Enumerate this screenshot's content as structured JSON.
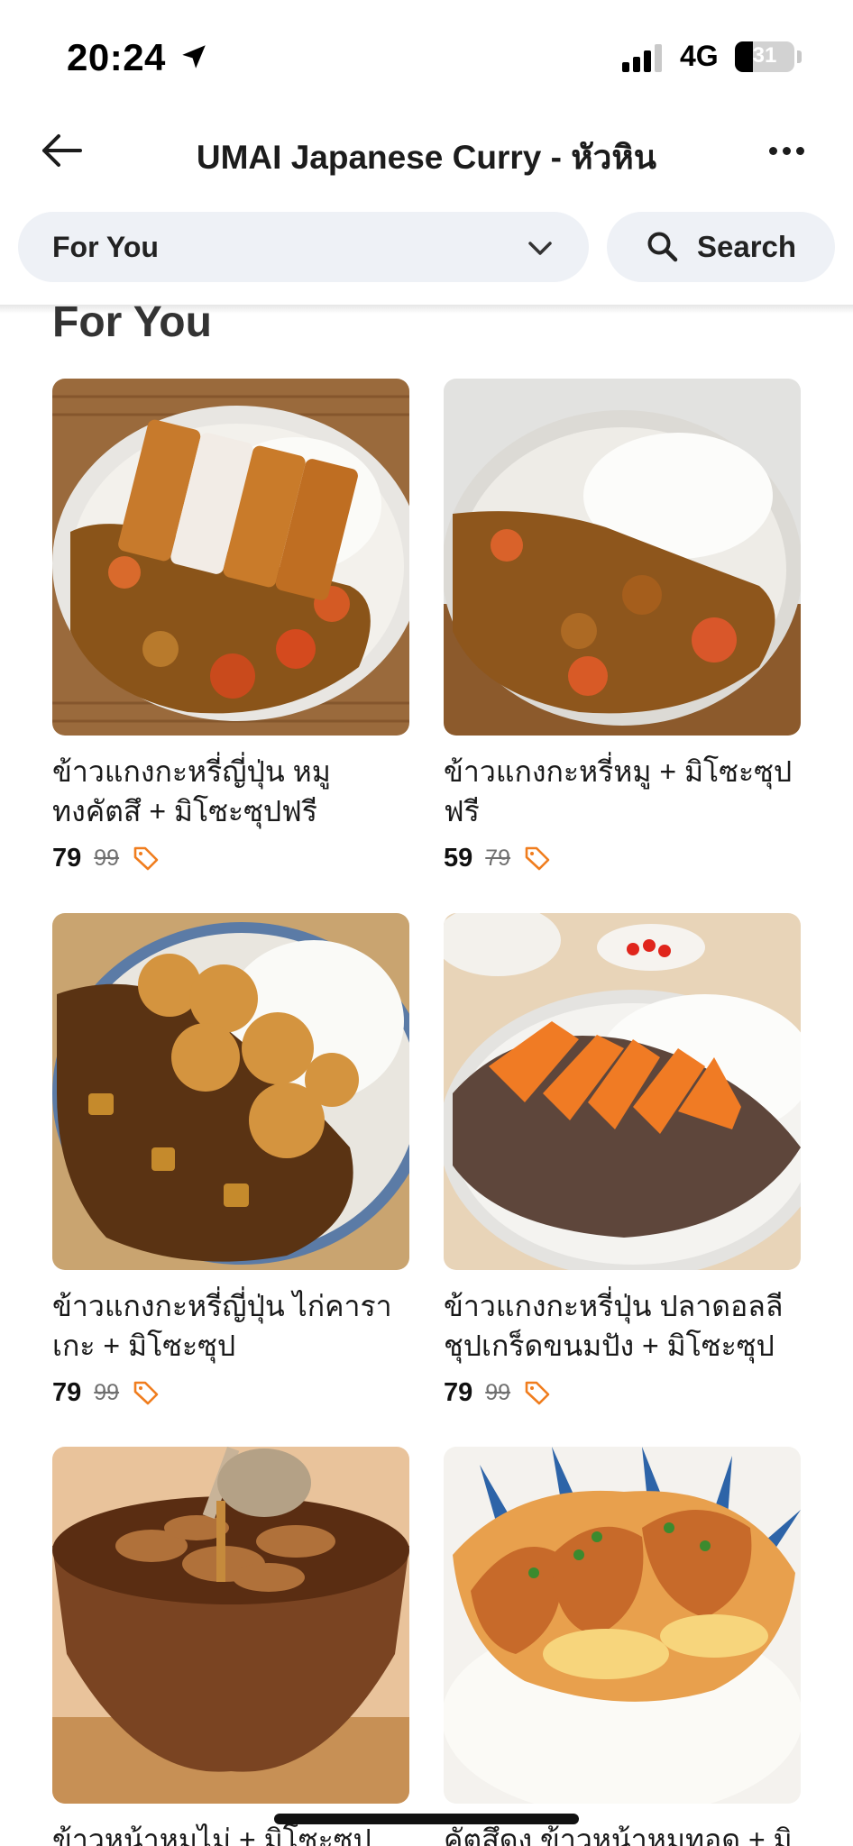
{
  "status_bar": {
    "time": "20:24",
    "network": "4G",
    "battery": "31",
    "battery_level": 0.31
  },
  "header": {
    "title": "UMAI Japanese Curry - หัวหิน"
  },
  "filter": {
    "category": "For You",
    "search_label": "Search"
  },
  "section": {
    "title": "For You"
  },
  "colors": {
    "tag_orange": "#f07d1e",
    "chip_bg": "#eef1f6"
  },
  "items": [
    {
      "name": "ข้าวแกงกะหรี่ญี่ปุ่น หมูทงคัตสึ + มิโซะซุปฟรี",
      "price": "79",
      "old_price": "99",
      "image": "pork-katsu-curry"
    },
    {
      "name": "ข้าวแกงกะหรี่หมู + มิโซะซุปฟรี",
      "price": "59",
      "old_price": "79",
      "image": "pork-curry"
    },
    {
      "name": "ข้าวแกงกะหรี่ญี่ปุ่น ไก่คาราเกะ + มิโซะซุป",
      "price": "79",
      "old_price": "99",
      "image": "chicken-karaage-curry"
    },
    {
      "name": "ข้าวแกงกะหรี่ปุ่น ปลาดอลลีชุปเกร็ดขนมปัง + มิโซะซุป",
      "price": "79",
      "old_price": "99",
      "image": "fried-fish-curry"
    },
    {
      "name": "ข้าวหน้าหมูไม่ + มิโซะซุป",
      "price": "",
      "old_price": "",
      "image": "pork-bowl"
    },
    {
      "name": "คัตสึดง ข้าวหน้าหมูทอด + มิ",
      "price": "",
      "old_price": "",
      "image": "katsudon"
    }
  ]
}
